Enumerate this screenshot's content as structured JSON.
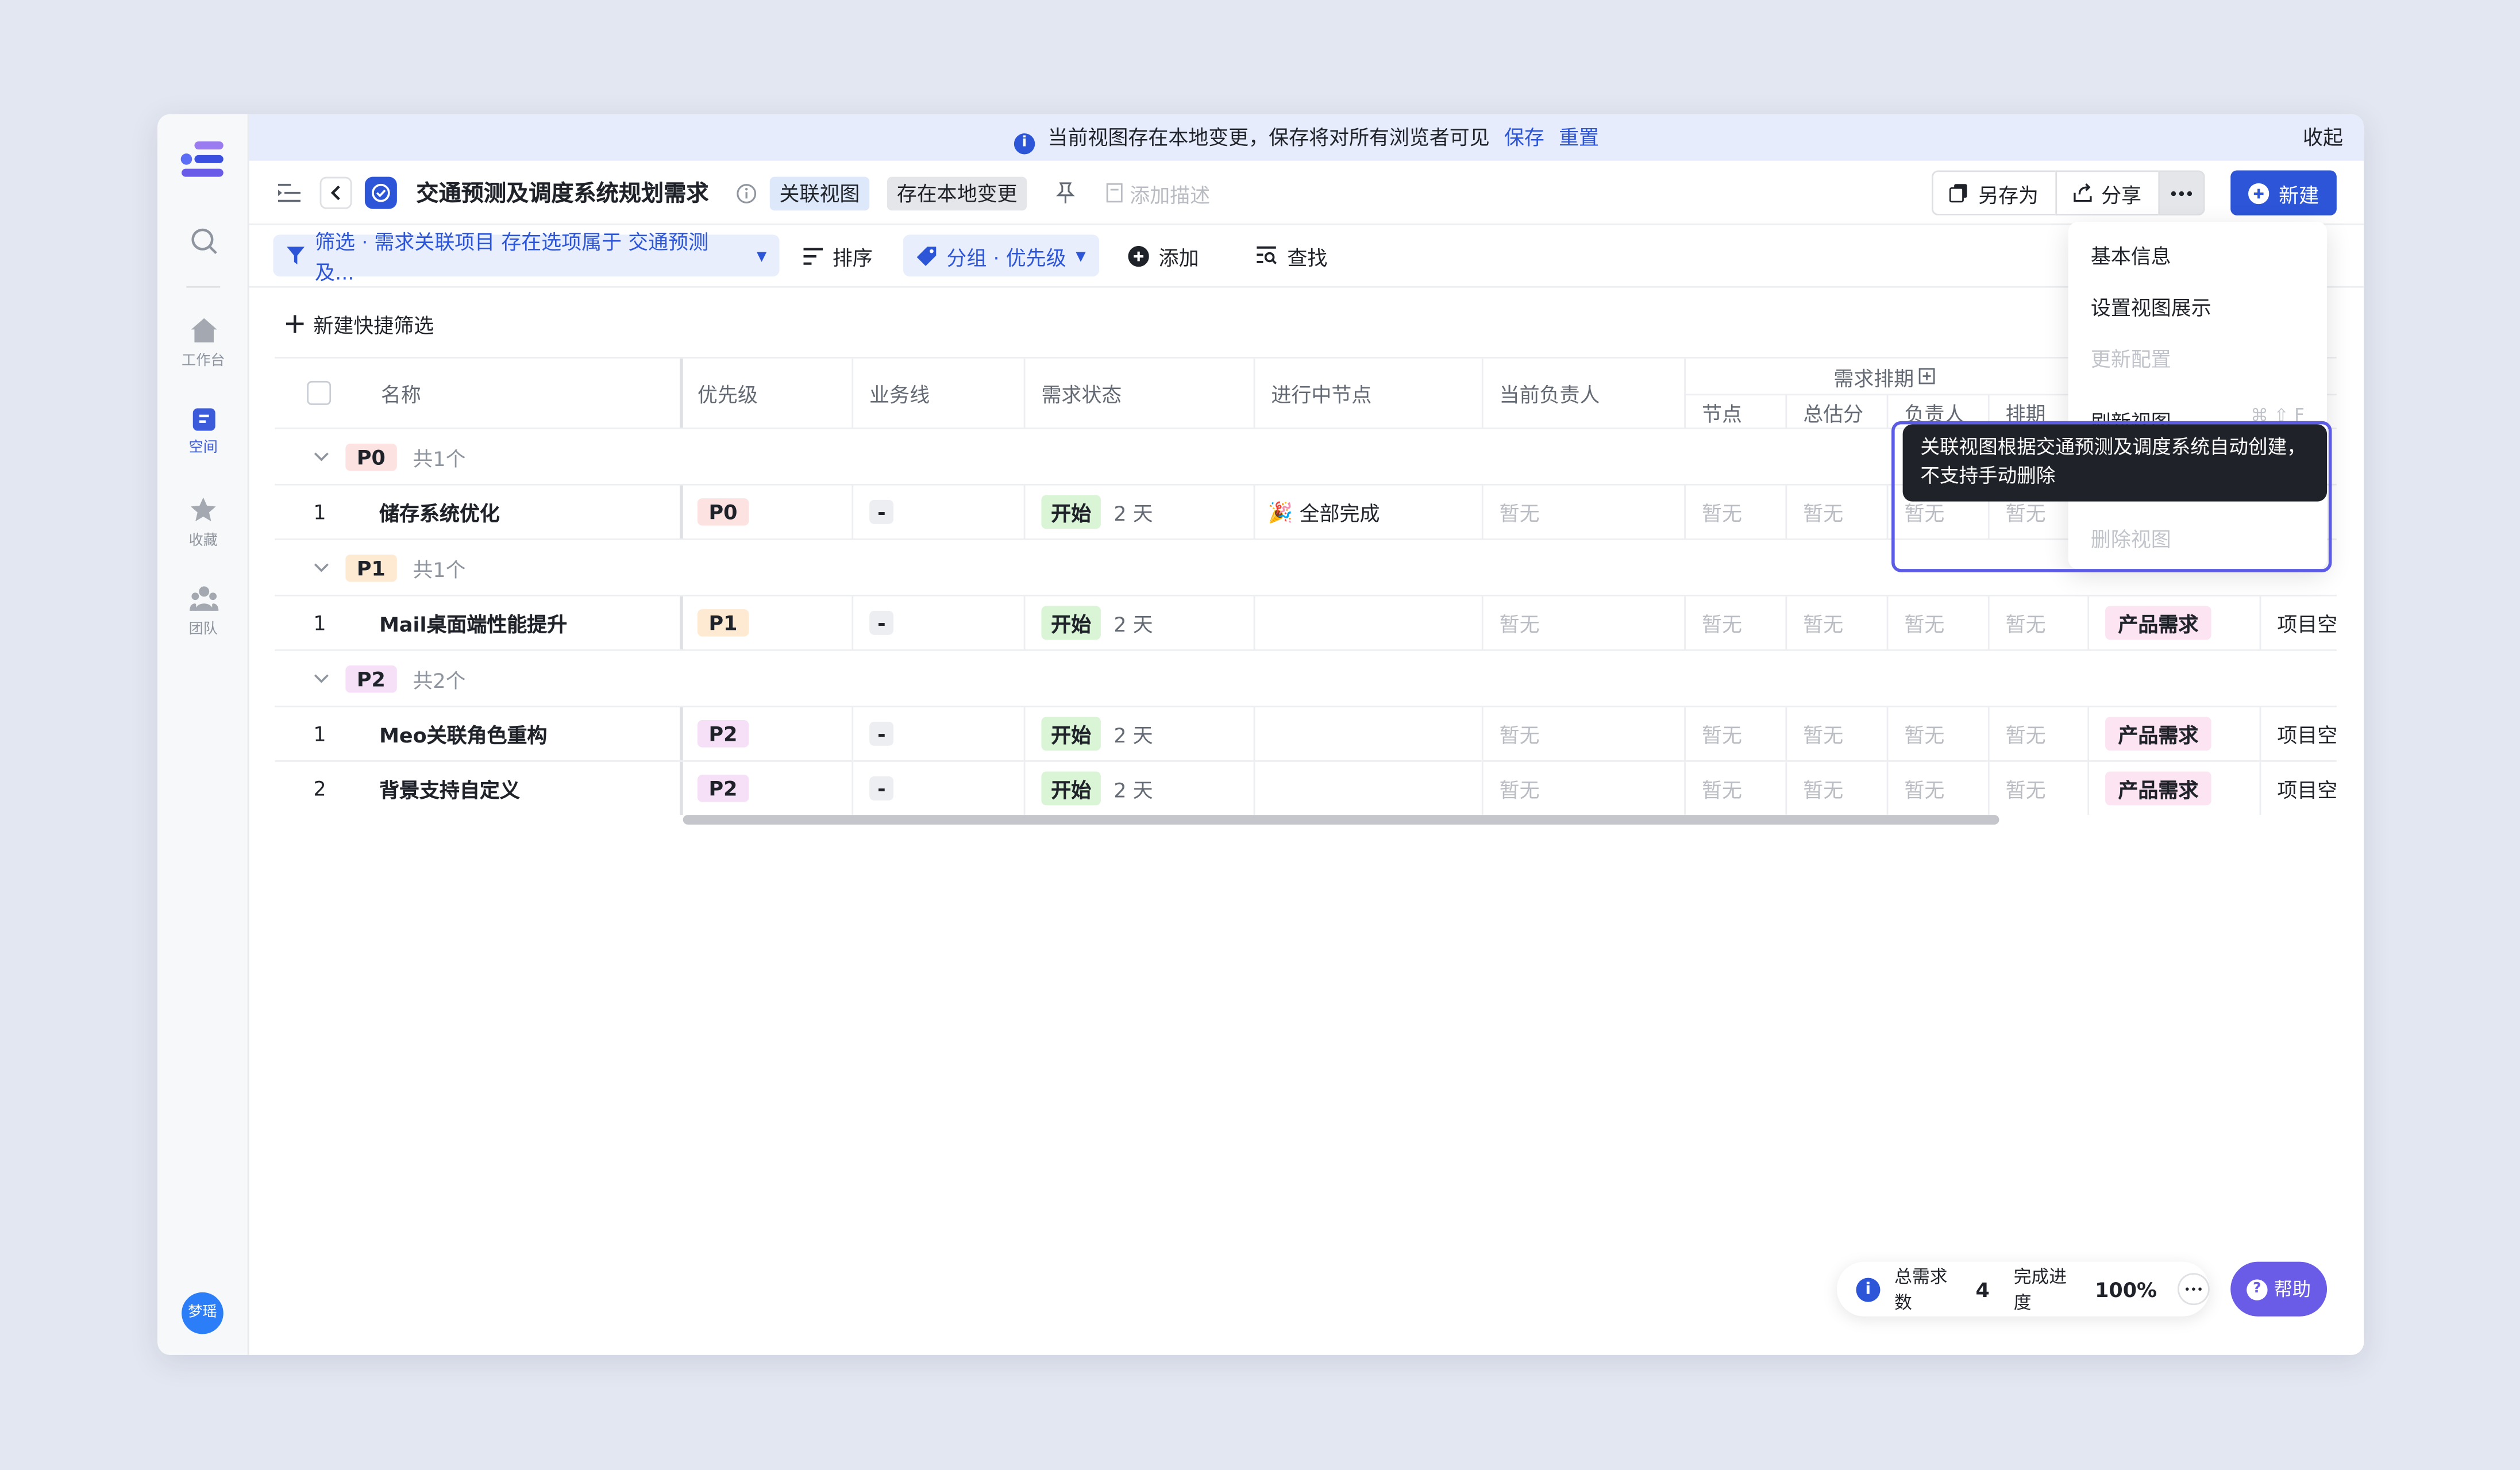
{
  "banner": {
    "message": "当前视图存在本地变更，保存将对所有浏览者可见",
    "save": "保存",
    "reset": "重置",
    "collapse": "收起"
  },
  "rail": {
    "workbench": "工作台",
    "space": "空间",
    "favorites": "收藏",
    "team": "团队",
    "avatar": "梦瑶"
  },
  "header": {
    "title": "交通预测及调度系统规划需求",
    "tag_linked_view": "关联视图",
    "tag_local_changes": "存在本地变更",
    "add_description": "添加描述",
    "save_as": "另存为",
    "share": "分享",
    "new": "新建"
  },
  "toolbar": {
    "filter": "筛选 · 需求关联项目 存在选项属于 交通预测及...",
    "sort": "排序",
    "group": "分组 · 优先级",
    "add": "添加",
    "find": "查找",
    "quick_filter": "新建快捷筛选"
  },
  "table": {
    "columns": {
      "name": "名称",
      "priority": "优先级",
      "business_line": "业务线",
      "status": "需求状态",
      "in_progress_node": "进行中节点",
      "owner": "当前负责人",
      "schedule_group": "需求排期",
      "node": "节点",
      "estimate": "总估分",
      "assignee": "负责人",
      "schedule": "排期"
    },
    "groups": [
      {
        "label": "P0",
        "count": "共1个",
        "rows": [
          {
            "index": "1",
            "name": "储存系统优化",
            "priority": "P0",
            "business_line": "-",
            "status": "开始",
            "duration": "2 天",
            "node": "全部完成",
            "owner": "暂无",
            "c1": "暂无",
            "c2": "暂无",
            "c3": "暂无",
            "c4": "暂无",
            "type": "",
            "project": ""
          }
        ]
      },
      {
        "label": "P1",
        "count": "共1个",
        "rows": [
          {
            "index": "1",
            "name": "Mail桌面端性能提升",
            "priority": "P1",
            "business_line": "-",
            "status": "开始",
            "duration": "2 天",
            "node": "",
            "owner": "暂无",
            "c1": "暂无",
            "c2": "暂无",
            "c3": "暂无",
            "c4": "暂无",
            "type": "产品需求",
            "project": "项目空"
          }
        ]
      },
      {
        "label": "P2",
        "count": "共2个",
        "rows": [
          {
            "index": "1",
            "name": "Meo关联角色重构",
            "priority": "P2",
            "business_line": "-",
            "status": "开始",
            "duration": "2 天",
            "node": "",
            "owner": "暂无",
            "c1": "暂无",
            "c2": "暂无",
            "c3": "暂无",
            "c4": "暂无",
            "type": "产品需求",
            "project": "项目空"
          },
          {
            "index": "2",
            "name": "背景支持自定义",
            "priority": "P2",
            "business_line": "-",
            "status": "开始",
            "duration": "2 天",
            "node": "",
            "owner": "暂无",
            "c1": "暂无",
            "c2": "暂无",
            "c3": "暂无",
            "c4": "暂无",
            "type": "产品需求",
            "project": "项目空"
          }
        ]
      }
    ]
  },
  "menu": {
    "basic_info": "基本信息",
    "display_settings": "设置视图展示",
    "update_config": "更新配置",
    "refresh_view": "刷新视图",
    "refresh_shortcut": "⌘ ⇧ F",
    "delete_view": "删除视图"
  },
  "tooltip": {
    "text": "关联视图根据交通预测及调度系统自动创建，不支持手动删除"
  },
  "footer": {
    "total_label": "总需求数",
    "total_value": "4",
    "progress_label": "完成进度",
    "progress_value": "100%",
    "help": "帮助"
  },
  "colors": {
    "accent": "#2c55d8",
    "banner_bg": "#e6ecfb",
    "help_bg": "#6b5ce7",
    "tooltip_bg": "#1f2329"
  }
}
